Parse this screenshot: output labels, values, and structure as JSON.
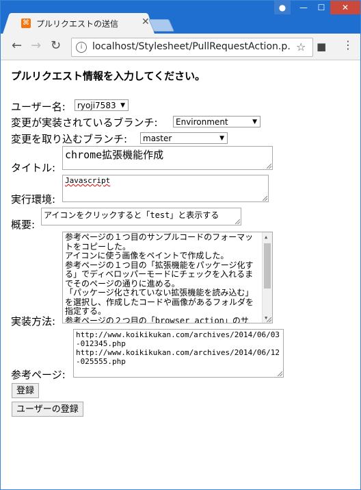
{
  "window": {
    "tab_title": "プルリクエストの送信",
    "url": "localhost/Stylesheet/PullRequestAction.p…",
    "icons": [
      "xampp-icon",
      "close-icon",
      "user-icon",
      "minimize-icon",
      "maximize-icon",
      "close-window-icon",
      "back-icon",
      "forward-icon",
      "reload-icon",
      "info-icon",
      "star-icon",
      "camera-icon",
      "menu-icon"
    ]
  },
  "page": {
    "heading": "プルリクエスト情報を入力してください。",
    "username_label": "ユーザー名:",
    "username_value": "ryoji7583",
    "branch_label": "変更が実装されているブランチ:",
    "branch_value": "Environment",
    "target_label": "変更を取り込むブランチ:",
    "target_value": "master",
    "title_label": "タイトル:",
    "title_value": "chrome拡張機能作成",
    "env_label": "実行環境:",
    "env_value": "Javascript",
    "summary_label": "概要:",
    "summary_value": "アイコンをクリックすると「test」と表示する",
    "impl_label": "実装方法:",
    "impl_value": "参考ページの１つ目のサンプルコードのフォーマットをコピーした。\nアイコンに使う画像をペイントで作成した。\n参考ページの１つ目の「拡張機能をパッケージ化する」でディベロッパーモードにチェックを入れるまでそのページの通りに進める。\n「パッケージ化されていない拡張機能を読み込む」を選択し、作成したコードや画像があるフォルダを指定する。\n参考ページの２つ目の「browser_action」のサ",
    "ref_label": "参考ページ:",
    "ref_value": "http://www.koikikukan.com/archives/2014/06/03-012345.php\nhttp://www.koikikukan.com/archives/2014/06/12-025555.php",
    "register_button": "登録",
    "register_user_button": "ユーザーの登録"
  }
}
